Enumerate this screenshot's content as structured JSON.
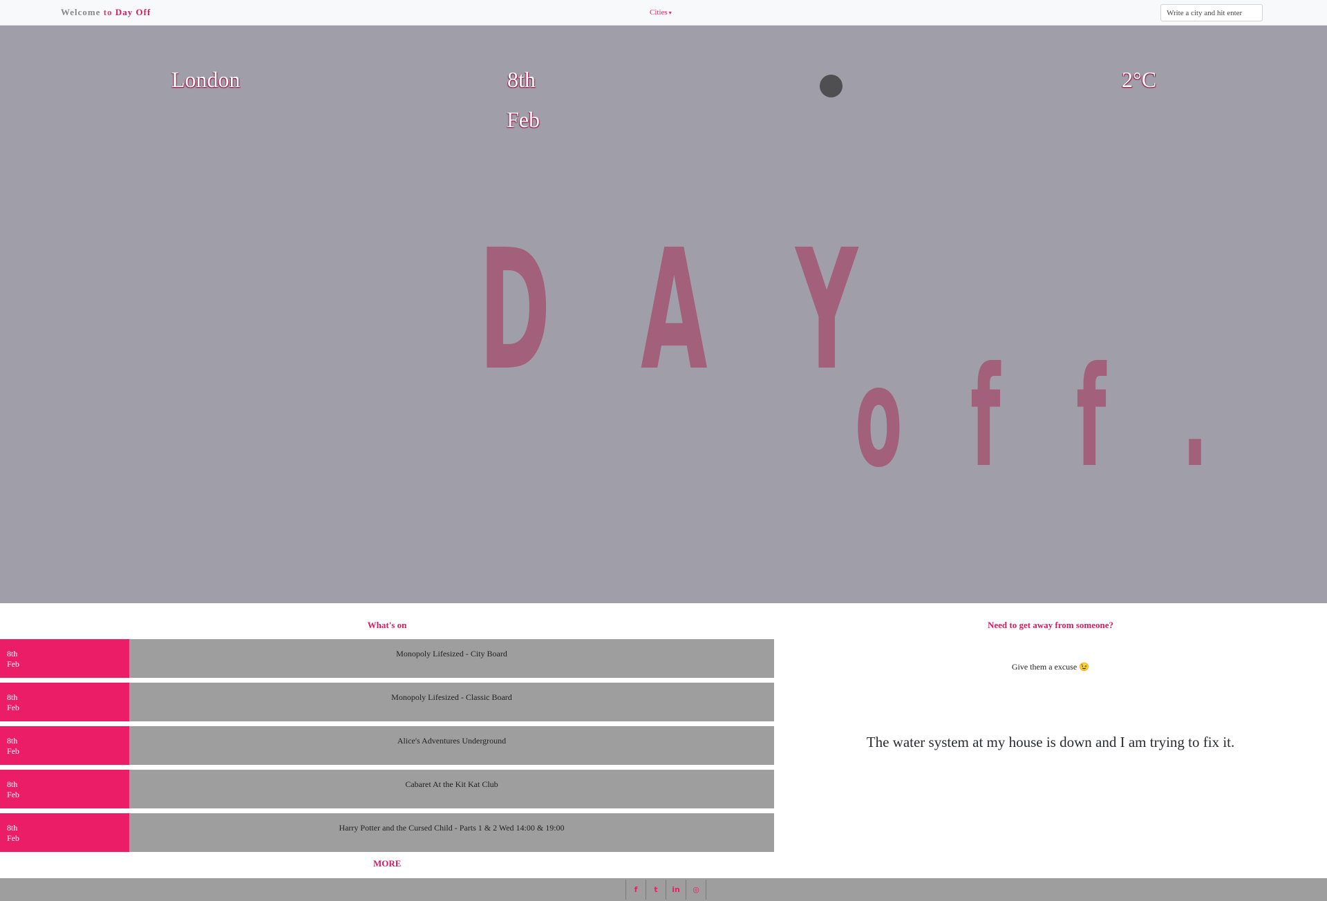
{
  "navbar": {
    "brand_welcome": "Welcome",
    "brand_to": "to",
    "brand_name": "Day Off",
    "cities_label": "Cities",
    "search_placeholder": "Write a city and hit enter"
  },
  "hero": {
    "city": "London",
    "date_day": "8th",
    "date_month": "Feb",
    "temperature": "2°C",
    "weather_icon": "moon-icon",
    "logo_letters_top": [
      "D",
      "A",
      "Y"
    ],
    "logo_letters_bottom": [
      "o",
      "f",
      "f",
      "."
    ]
  },
  "whats_on": {
    "title": "What's on",
    "events": [
      {
        "day": "8th",
        "month": "Feb",
        "name": "Monopoly Lifesized - City Board"
      },
      {
        "day": "8th",
        "month": "Feb",
        "name": "Monopoly Lifesized - Classic Board"
      },
      {
        "day": "8th",
        "month": "Feb",
        "name": "Alice's Adventures Underground"
      },
      {
        "day": "8th",
        "month": "Feb",
        "name": "Cabaret At the Kit Kat Club"
      },
      {
        "day": "8th",
        "month": "Feb",
        "name": "Harry Potter and the Cursed Child - Parts 1 & 2 Wed 14:00 & 19:00"
      }
    ],
    "more_label": "MORE"
  },
  "excuse": {
    "title": "Need to get away from someone?",
    "lead": "Give them a excuse 😉",
    "text": "The water system at my house is down and I am trying to fix it."
  },
  "footer": {
    "social": [
      {
        "icon": "facebook-icon",
        "glyph": "f"
      },
      {
        "icon": "twitter-icon",
        "glyph": "t"
      },
      {
        "icon": "linkedin-icon",
        "glyph": "in"
      },
      {
        "icon": "github-icon",
        "glyph": "◎"
      }
    ]
  },
  "colors": {
    "accent": "#e91e63",
    "hero_bg": "#a09ea8",
    "logo": "#a2607a",
    "event_bg": "#9e9e9e",
    "date_bg": "#ea1d66"
  }
}
